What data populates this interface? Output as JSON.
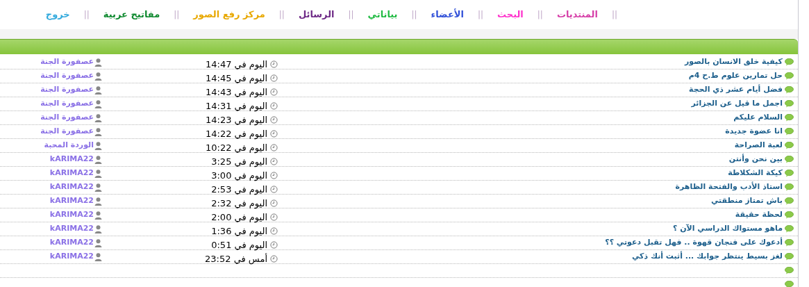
{
  "nav": [
    {
      "label": "المنتديات",
      "color": "#d63fa8"
    },
    {
      "label": "البحث",
      "color": "#ff33cc"
    },
    {
      "label": "الأعضاء",
      "color": "#2f4fd8"
    },
    {
      "label": "بياناتي",
      "color": "#22bb44"
    },
    {
      "label": "الرسائل",
      "color": "#6e2a86"
    },
    {
      "label": "مركز رفع الصور",
      "color": "#e8a800"
    },
    {
      "label": "مفاتيح عربية",
      "color": "#108a30"
    },
    {
      "label": "خروج",
      "color": "#33aadd"
    }
  ],
  "separator": "||",
  "topics": [
    {
      "kind": "topic",
      "title": "كيفية خلق الانسان بالصور",
      "time": "اليوم في 14:47",
      "author": "عصفورة الجنة"
    },
    {
      "kind": "topic",
      "title": "حل تمارين علوم ط.ح 4م",
      "time": "اليوم في 14:45",
      "author": "عصفورة الجنة"
    },
    {
      "kind": "topic",
      "title": "فضل أيام عشر ذي الحجة",
      "time": "اليوم في 14:43",
      "author": "عصفورة الجنة"
    },
    {
      "kind": "topic",
      "title": "اجمل ما قيل عن الجزائر",
      "time": "اليوم في 14:31",
      "author": "عصفورة الجنة"
    },
    {
      "kind": "topic",
      "title": "السلام عليكم",
      "time": "اليوم في 14:23",
      "author": "عصفورة الجنة"
    },
    {
      "kind": "topic",
      "title": "انا عضوة جديدة",
      "time": "اليوم في 14:22",
      "author": "عصفورة الجنة"
    },
    {
      "kind": "topic",
      "title": "لعبة الصراحة",
      "time": "اليوم في 10:22",
      "author": "الوردة المحبة"
    },
    {
      "kind": "topic",
      "title": "بين نحن وأنتن",
      "time": "اليوم في 3:25",
      "author": "kARIMA22"
    },
    {
      "kind": "topic",
      "title": "كيكة الشكلاطة",
      "time": "اليوم في 3:00",
      "author": "kARIMA22"
    },
    {
      "kind": "topic",
      "title": "استاذ الأدب والفتحة الظاهرة",
      "time": "اليوم في 2:53",
      "author": "kARIMA22"
    },
    {
      "kind": "topic",
      "title": "باش تمتاز منطقتي",
      "time": "اليوم في 2:32",
      "author": "kARIMA22"
    },
    {
      "kind": "topic",
      "title": "لحظة حقيقة",
      "time": "اليوم في 2:00",
      "author": "kARIMA22"
    },
    {
      "kind": "topic",
      "title": "ماهو مستواك الدراسي الآن ؟",
      "time": "اليوم في 1:36",
      "author": "kARIMA22"
    },
    {
      "kind": "topic",
      "title": "أدعوك على فنجان قهوة .. فهل تقبل دعوتي ؟؟",
      "time": "اليوم في 0:51",
      "author": "kARIMA22"
    },
    {
      "kind": "topic",
      "title": "لغز بسيط ينتظر جوابك ... أثبت أنك ذكي",
      "time": "أمس في 23:52",
      "author": "kARIMA22"
    },
    {
      "kind": "empty"
    },
    {
      "kind": "empty"
    }
  ]
}
